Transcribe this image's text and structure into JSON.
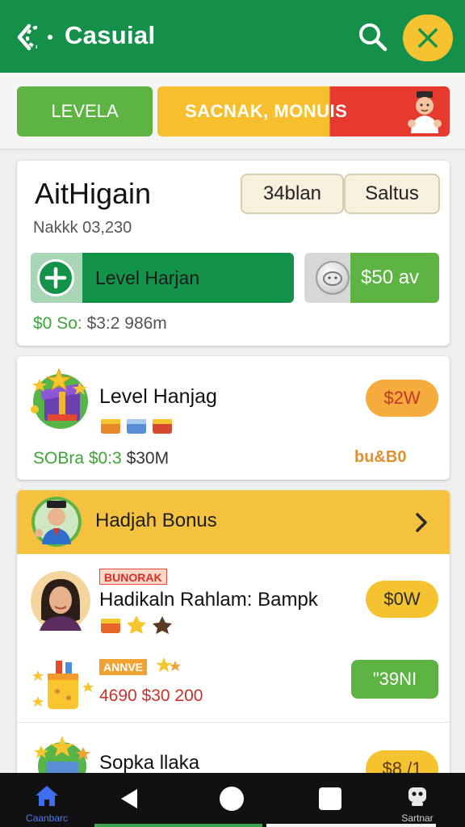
{
  "header": {
    "title": "Casuial",
    "colors": {
      "bar": "#14904a",
      "close_button": "#f6c330"
    }
  },
  "tabs": {
    "level_label": "LEVELA",
    "bonus_label": "SACNAK, MONUIS"
  },
  "summary_card": {
    "title": "AitHigain",
    "subtitle": "Nakkk 03,230",
    "chip_a": "34blan",
    "chip_b": "Saltus",
    "level_button": "Level Harjan",
    "cash_button": "$50 av",
    "footer_green": "$0 So:",
    "footer_rest": "$3:2 986m"
  },
  "level_card": {
    "title": "Level Hanjag",
    "footer_green": "SOBra $0:3",
    "footer_rest": "$30M",
    "price_pill": "$2W",
    "badge": "bu&B0"
  },
  "bonus_card": {
    "header_title": "Hadjah Bonus",
    "row1": {
      "tag": "BUNORAK",
      "title": "Hadikaln Rahlam: Bampk",
      "price_pill": "$0W",
      "tag2": "ANNVE",
      "footer": "4690 $30 200",
      "action_pill": "\"39NI"
    },
    "row2": {
      "title": "Sopka llaka",
      "price_pill": "$8 /1"
    }
  },
  "navbar": {
    "home_label": "Caanbarc",
    "profile_label": "Sartnar",
    "icons": [
      "home-icon",
      "back-icon",
      "home-circle-icon",
      "recents-icon",
      "profile-icon"
    ]
  }
}
